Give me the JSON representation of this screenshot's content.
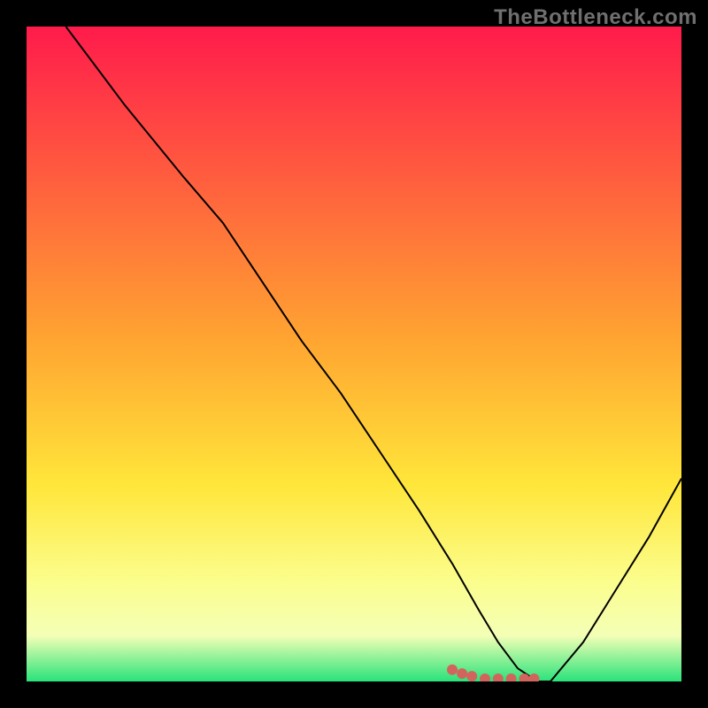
{
  "watermark": "TheBottleneck.com",
  "chart_data": {
    "type": "line",
    "title": "",
    "xlabel": "",
    "ylabel": "",
    "xlim": [
      0,
      100
    ],
    "ylim": [
      0,
      100
    ],
    "grid": false,
    "legend": false,
    "gradient_stops": [
      {
        "offset": 0,
        "color": "#ff1b4b"
      },
      {
        "offset": 48,
        "color": "#ffa531"
      },
      {
        "offset": 70,
        "color": "#ffe63a"
      },
      {
        "offset": 85,
        "color": "#fbfe8e"
      },
      {
        "offset": 93,
        "color": "#f4ffb6"
      },
      {
        "offset": 100,
        "color": "#29e37a"
      }
    ],
    "series": [
      {
        "name": "bottleneck-curve",
        "color": "#000000",
        "width": 2,
        "x": [
          6,
          15,
          24,
          30,
          36,
          42,
          48,
          54,
          60,
          65,
          69,
          72,
          75,
          78,
          80,
          85,
          90,
          95,
          100
        ],
        "y": [
          100,
          88,
          77,
          70,
          61,
          52,
          44,
          35,
          26,
          18,
          11,
          6,
          2,
          0,
          0,
          6,
          14,
          22,
          31
        ]
      },
      {
        "name": "highlight-dots",
        "color": "#d1655e",
        "type": "scatter",
        "radius": 6,
        "x": [
          65,
          66.5,
          68,
          70,
          72,
          74,
          76,
          77.5
        ],
        "y": [
          1.8,
          1.2,
          0.8,
          0.4,
          0.4,
          0.4,
          0.4,
          0.4
        ]
      }
    ]
  }
}
